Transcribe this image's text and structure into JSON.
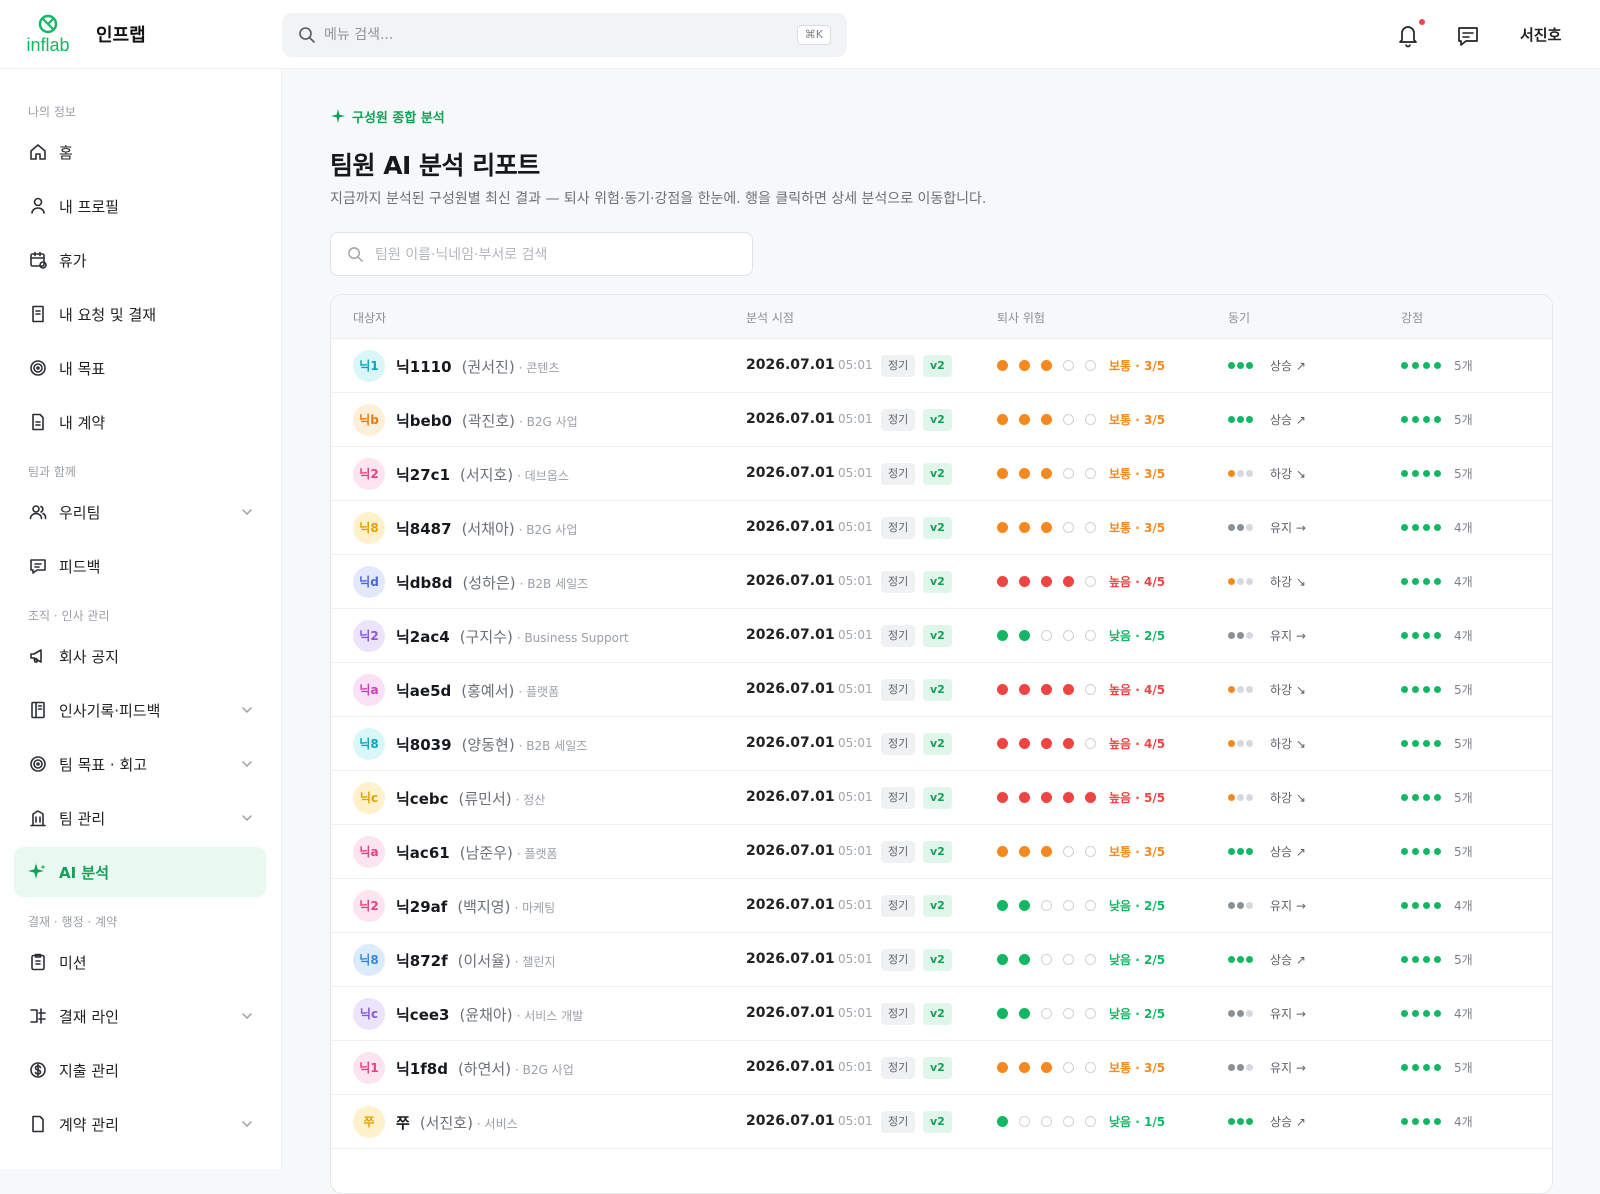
{
  "header": {
    "brand": "인프랩",
    "logo_text": "inflab",
    "search_placeholder": "메뉴 검색...",
    "search_shortcut": "⌘K",
    "user_name": "서진호"
  },
  "sidebar": {
    "sections": [
      {
        "title": "나의 정보",
        "items": [
          {
            "label": "홈",
            "icon": "home-icon",
            "chevron": false
          },
          {
            "label": "내 프로필",
            "icon": "user-icon",
            "chevron": false
          },
          {
            "label": "휴가",
            "icon": "calendar-icon",
            "chevron": false
          },
          {
            "label": "내 요청 및 결재",
            "icon": "request-icon",
            "chevron": false
          },
          {
            "label": "내 목표",
            "icon": "target-icon",
            "chevron": false
          },
          {
            "label": "내 계약",
            "icon": "document-icon",
            "chevron": false
          }
        ]
      },
      {
        "title": "팀과 함께",
        "items": [
          {
            "label": "우리팀",
            "icon": "team-icon",
            "chevron": true
          },
          {
            "label": "피드백",
            "icon": "feedback-icon",
            "chevron": false
          }
        ]
      },
      {
        "title": "조직 · 인사 관리",
        "items": [
          {
            "label": "회사 공지",
            "icon": "megaphone-icon",
            "chevron": false
          },
          {
            "label": "인사기록·피드백",
            "icon": "record-icon",
            "chevron": true
          },
          {
            "label": "팀 목표 · 회고",
            "icon": "target-icon",
            "chevron": true
          },
          {
            "label": "팀 관리",
            "icon": "building-icon",
            "chevron": true
          },
          {
            "label": "AI 분석",
            "icon": "sparkle-icon",
            "chevron": false,
            "active": true
          }
        ]
      },
      {
        "title": "결재 · 행정 · 계약",
        "items": [
          {
            "label": "미션",
            "icon": "clipboard-icon",
            "chevron": false
          },
          {
            "label": "결재 라인",
            "icon": "approval-line-icon",
            "chevron": true
          },
          {
            "label": "지출 관리",
            "icon": "dollar-icon",
            "chevron": false
          },
          {
            "label": "계약 관리",
            "icon": "contract-icon",
            "chevron": true
          }
        ]
      }
    ]
  },
  "main": {
    "eyebrow": "구성원 종합 분석",
    "title": "팀원 AI 분석 리포트",
    "description": "지금까지 분석된 구성원별 최신 결과 — 퇴사 위험·동기·강점을 한눈에. 행을 클릭하면 상세 분석으로 이동합니다.",
    "search_placeholder": "팀원 이름·닉네임·부서로 검색"
  },
  "table": {
    "columns": [
      "대상자",
      "분석 시점",
      "퇴사 위험",
      "동기",
      "강점"
    ],
    "colors": {
      "orange": "#f5891f",
      "red": "#ef4444",
      "green": "#12b764",
      "grey": "#9aa0a7",
      "light": "#d5d8dc"
    },
    "rows": [
      {
        "avatar": "닉1",
        "av_bg": "#d9f6f9",
        "av_fg": "#0fa5b8",
        "nick": "닉1110",
        "name": "(권서진)",
        "dept": "· 콘텐츠",
        "date": "2026.07.01",
        "time": "05:01",
        "type": "정기",
        "ver": "v2",
        "risk": 3,
        "risk_label": "보통 · 3/5",
        "risk_color": "#f5891f",
        "motivation": "상승 ↗",
        "mot_level": 3,
        "mot_color": "#12b764",
        "strength_count": 4,
        "strength_label": "5개"
      },
      {
        "avatar": "닉b",
        "av_bg": "#ffeed8",
        "av_fg": "#e57b16",
        "nick": "닉beb0",
        "name": "(곽진호)",
        "dept": "· B2G 사업",
        "date": "2026.07.01",
        "time": "05:01",
        "type": "정기",
        "ver": "v2",
        "risk": 3,
        "risk_label": "보통 · 3/5",
        "risk_color": "#f5891f",
        "motivation": "상승 ↗",
        "mot_level": 3,
        "mot_color": "#12b764",
        "strength_count": 4,
        "strength_label": "5개"
      },
      {
        "avatar": "닉2",
        "av_bg": "#fde4ee",
        "av_fg": "#e0457b",
        "nick": "닉27c1",
        "name": "(서지호)",
        "dept": "· 데브옵스",
        "date": "2026.07.01",
        "time": "05:01",
        "type": "정기",
        "ver": "v2",
        "risk": 3,
        "risk_label": "보통 · 3/5",
        "risk_color": "#f5891f",
        "motivation": "하강 ↘",
        "mot_level": 1,
        "mot_color": "#f5891f",
        "strength_count": 4,
        "strength_label": "5개"
      },
      {
        "avatar": "닉8",
        "av_bg": "#fff1cc",
        "av_fg": "#e2a300",
        "nick": "닉8487",
        "name": "(서채아)",
        "dept": "· B2G 사업",
        "date": "2026.07.01",
        "time": "05:01",
        "type": "정기",
        "ver": "v2",
        "risk": 3,
        "risk_label": "보통 · 3/5",
        "risk_color": "#f5891f",
        "motivation": "유지 →",
        "mot_level": 2,
        "mot_color": "#8a9097",
        "strength_count": 4,
        "strength_label": "4개"
      },
      {
        "avatar": "닉d",
        "av_bg": "#e3e8fb",
        "av_fg": "#4b66d6",
        "nick": "닉db8d",
        "name": "(성하은)",
        "dept": "· B2B 세일즈",
        "date": "2026.07.01",
        "time": "05:01",
        "type": "정기",
        "ver": "v2",
        "risk": 4,
        "risk_label": "높음 · 4/5",
        "risk_color": "#ef4444",
        "motivation": "하강 ↘",
        "mot_level": 1,
        "mot_color": "#f5891f",
        "strength_count": 4,
        "strength_label": "4개"
      },
      {
        "avatar": "닉2",
        "av_bg": "#ece4fb",
        "av_fg": "#8759d6",
        "nick": "닉2ac4",
        "name": "(구지수)",
        "dept": "· Business Support",
        "date": "2026.07.01",
        "time": "05:01",
        "type": "정기",
        "ver": "v2",
        "risk": 2,
        "risk_label": "낮음 · 2/5",
        "risk_color": "#12b764",
        "motivation": "유지 →",
        "mot_level": 2,
        "mot_color": "#8a9097",
        "strength_count": 4,
        "strength_label": "4개"
      },
      {
        "avatar": "닉a",
        "av_bg": "#fae1f6",
        "av_fg": "#cc40b5",
        "nick": "닉ae5d",
        "name": "(홍예서)",
        "dept": "· 플랫폼",
        "date": "2026.07.01",
        "time": "05:01",
        "type": "정기",
        "ver": "v2",
        "risk": 4,
        "risk_label": "높음 · 4/5",
        "risk_color": "#ef4444",
        "motivation": "하강 ↘",
        "mot_level": 1,
        "mot_color": "#f5891f",
        "strength_count": 4,
        "strength_label": "5개"
      },
      {
        "avatar": "닉8",
        "av_bg": "#d9f6f9",
        "av_fg": "#0fa5b8",
        "nick": "닉8039",
        "name": "(양동현)",
        "dept": "· B2B 세일즈",
        "date": "2026.07.01",
        "time": "05:01",
        "type": "정기",
        "ver": "v2",
        "risk": 4,
        "risk_label": "높음 · 4/5",
        "risk_color": "#ef4444",
        "motivation": "하강 ↘",
        "mot_level": 1,
        "mot_color": "#f5891f",
        "strength_count": 4,
        "strength_label": "5개"
      },
      {
        "avatar": "닉c",
        "av_bg": "#fff1cc",
        "av_fg": "#e2a300",
        "nick": "닉cebc",
        "name": "(류민서)",
        "dept": "· 정산",
        "date": "2026.07.01",
        "time": "05:01",
        "type": "정기",
        "ver": "v2",
        "risk": 5,
        "risk_label": "높음 · 5/5",
        "risk_color": "#ef4444",
        "motivation": "하강 ↘",
        "mot_level": 1,
        "mot_color": "#f5891f",
        "strength_count": 4,
        "strength_label": "5개"
      },
      {
        "avatar": "닉a",
        "av_bg": "#fde4ee",
        "av_fg": "#e0457b",
        "nick": "닉ac61",
        "name": "(남준우)",
        "dept": "· 플랫폼",
        "date": "2026.07.01",
        "time": "05:01",
        "type": "정기",
        "ver": "v2",
        "risk": 3,
        "risk_label": "보통 · 3/5",
        "risk_color": "#f5891f",
        "motivation": "상승 ↗",
        "mot_level": 3,
        "mot_color": "#12b764",
        "strength_count": 4,
        "strength_label": "5개"
      },
      {
        "avatar": "닉2",
        "av_bg": "#fde4ee",
        "av_fg": "#e0457b",
        "nick": "닉29af",
        "name": "(백지영)",
        "dept": "· 마케팅",
        "date": "2026.07.01",
        "time": "05:01",
        "type": "정기",
        "ver": "v2",
        "risk": 2,
        "risk_label": "낮음 · 2/5",
        "risk_color": "#12b764",
        "motivation": "유지 →",
        "mot_level": 2,
        "mot_color": "#8a9097",
        "strength_count": 4,
        "strength_label": "4개"
      },
      {
        "avatar": "닉8",
        "av_bg": "#dcebfb",
        "av_fg": "#3a86d6",
        "nick": "닉872f",
        "name": "(이서율)",
        "dept": "· 챌린지",
        "date": "2026.07.01",
        "time": "05:01",
        "type": "정기",
        "ver": "v2",
        "risk": 2,
        "risk_label": "낮음 · 2/5",
        "risk_color": "#12b764",
        "motivation": "상승 ↗",
        "mot_level": 3,
        "mot_color": "#12b764",
        "strength_count": 4,
        "strength_label": "5개"
      },
      {
        "avatar": "닉c",
        "av_bg": "#ece4fb",
        "av_fg": "#8759d6",
        "nick": "닉cee3",
        "name": "(윤채아)",
        "dept": "· 서비스 개발",
        "date": "2026.07.01",
        "time": "05:01",
        "type": "정기",
        "ver": "v2",
        "risk": 2,
        "risk_label": "낮음 · 2/5",
        "risk_color": "#12b764",
        "motivation": "유지 →",
        "mot_level": 2,
        "mot_color": "#8a9097",
        "strength_count": 4,
        "strength_label": "4개"
      },
      {
        "avatar": "닉1",
        "av_bg": "#fde4ee",
        "av_fg": "#e0457b",
        "nick": "닉1f8d",
        "name": "(하연서)",
        "dept": "· B2G 사업",
        "date": "2026.07.01",
        "time": "05:01",
        "type": "정기",
        "ver": "v2",
        "risk": 3,
        "risk_label": "보통 · 3/5",
        "risk_color": "#f5891f",
        "motivation": "유지 →",
        "mot_level": 2,
        "mot_color": "#8a9097",
        "strength_count": 4,
        "strength_label": "5개"
      },
      {
        "avatar": "쭈",
        "av_bg": "#fff1cc",
        "av_fg": "#e2a300",
        "nick": "쭈",
        "name": "(서진호)",
        "dept": "· 서비스",
        "date": "2026.07.01",
        "time": "05:01",
        "type": "정기",
        "ver": "v2",
        "risk": 1,
        "risk_label": "낮음 · 1/5",
        "risk_color": "#12b764",
        "motivation": "상승 ↗",
        "mot_level": 3,
        "mot_color": "#12b764",
        "strength_count": 4,
        "strength_label": "4개"
      }
    ]
  }
}
